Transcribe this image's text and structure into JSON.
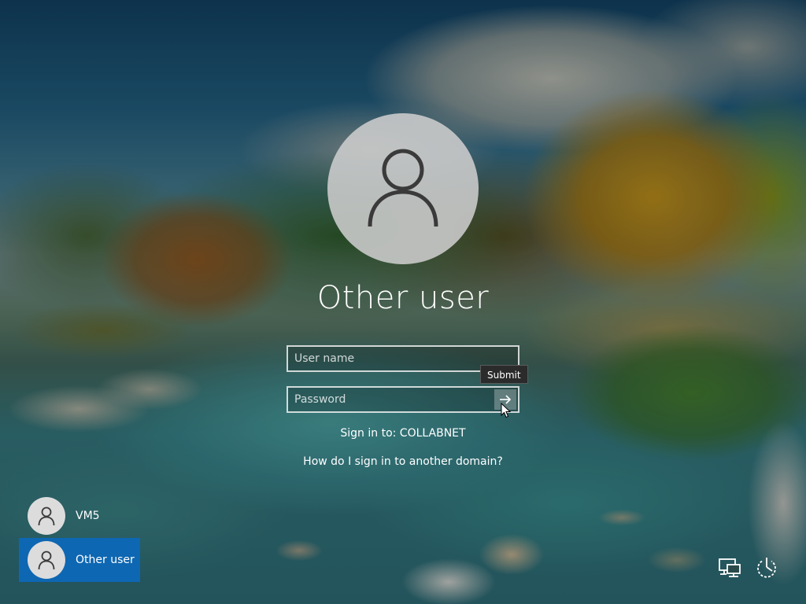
{
  "login": {
    "user_title": "Other user",
    "username_placeholder": "User name",
    "password_placeholder": "Password",
    "submit_tooltip": "Submit",
    "sign_in_to": "Sign in to: COLLABNET",
    "other_domain_link": "How do I sign in to another domain?"
  },
  "user_list": [
    {
      "name": "VM5",
      "selected": false,
      "icon": "user-icon"
    },
    {
      "name": "Other user",
      "selected": true,
      "icon": "user-icon"
    }
  ],
  "system_icons": {
    "network": "network-icon",
    "power": "power-icon"
  },
  "colors": {
    "selected_user_bg": "#0e67b2",
    "text": "#ffffff",
    "avatar_bg": "#cdcdcd",
    "tooltip_bg": "#2b2b2b"
  }
}
